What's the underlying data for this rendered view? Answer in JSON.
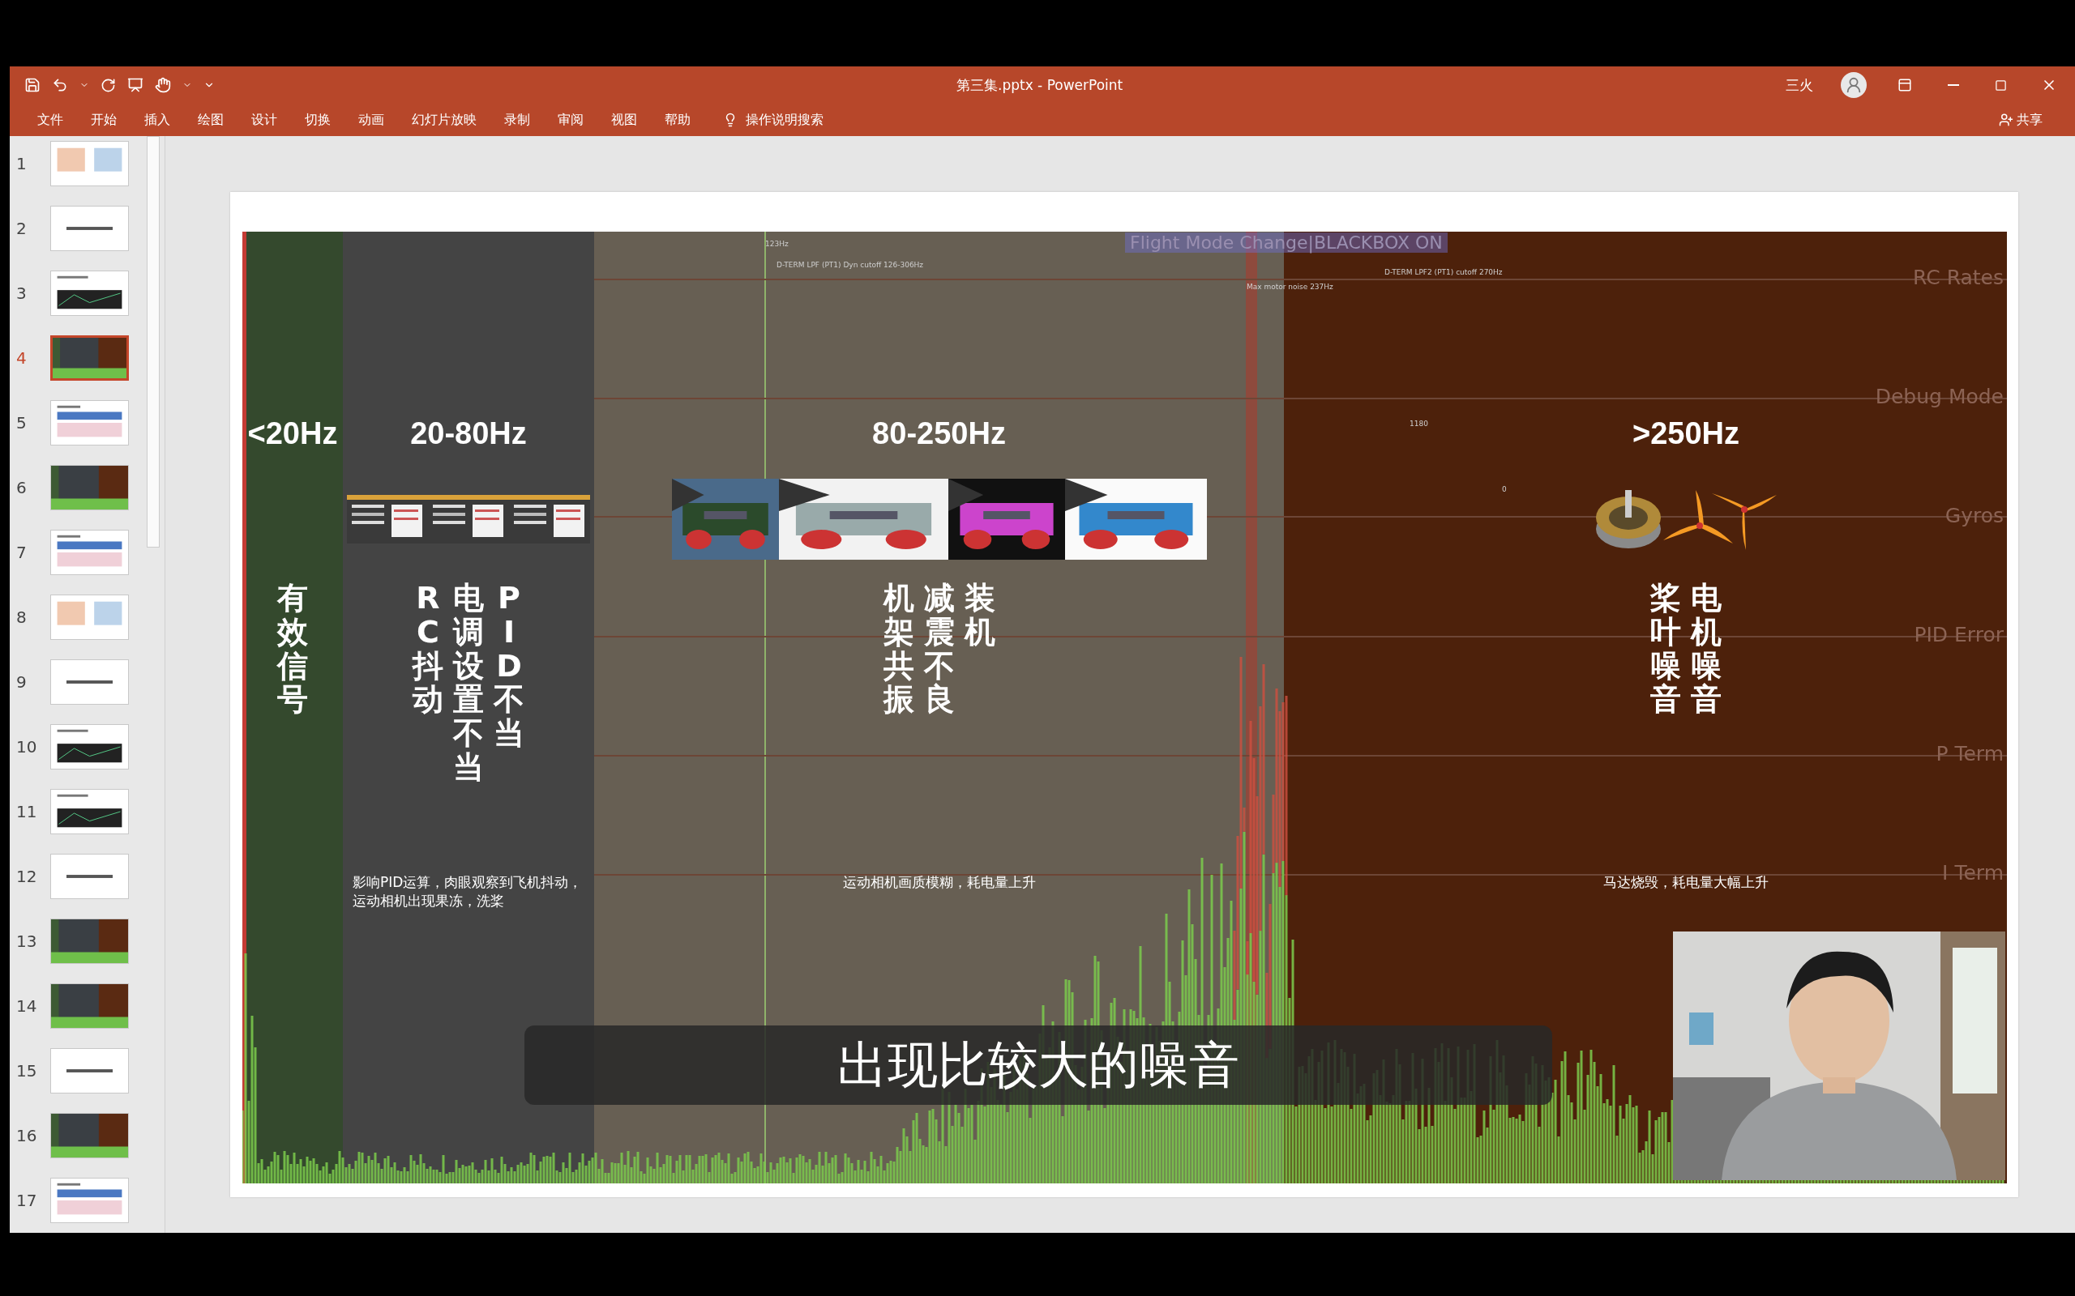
{
  "window": {
    "title": "第三集.pptx - PowerPoint",
    "user": "三火"
  },
  "ribbon": {
    "tabs": [
      "文件",
      "开始",
      "插入",
      "绘图",
      "设计",
      "切换",
      "动画",
      "幻灯片放映",
      "录制",
      "审阅",
      "视图",
      "帮助"
    ],
    "search": "操作说明搜索",
    "share": "共享"
  },
  "slides": [
    {
      "number": "1",
      "kind": "diagram",
      "selected": false
    },
    {
      "number": "2",
      "kind": "title",
      "selected": false
    },
    {
      "number": "3",
      "kind": "chart",
      "selected": false
    },
    {
      "number": "4",
      "kind": "dark",
      "selected": true
    },
    {
      "number": "5",
      "kind": "table",
      "selected": false
    },
    {
      "number": "6",
      "kind": "dark",
      "selected": false
    },
    {
      "number": "7",
      "kind": "table",
      "selected": false
    },
    {
      "number": "8",
      "kind": "diagram",
      "selected": false
    },
    {
      "number": "9",
      "kind": "title",
      "selected": false
    },
    {
      "number": "10",
      "kind": "chart",
      "selected": false
    },
    {
      "number": "11",
      "kind": "chart",
      "selected": false
    },
    {
      "number": "12",
      "kind": "title",
      "selected": false
    },
    {
      "number": "13",
      "kind": "dark",
      "selected": false
    },
    {
      "number": "14",
      "kind": "dark",
      "selected": false
    },
    {
      "number": "15",
      "kind": "title",
      "selected": false
    },
    {
      "number": "16",
      "kind": "dark",
      "selected": false
    },
    {
      "number": "17",
      "kind": "table",
      "selected": false
    }
  ],
  "slide": {
    "flight_mode": "Flight Mode Change|BLACKBOX ON",
    "markers": [
      "123Hz",
      "D-TERM LPF (PT1) Dyn cutoff 126-306Hz",
      "Max motor noise 237Hz",
      "D-TERM LPF2 (PT1) cutoff 270Hz",
      "1180",
      "0"
    ],
    "chart_labels": [
      "RC Rates",
      "Debug Mode",
      "Gyros",
      "PID Error",
      "P Term",
      "I Term"
    ],
    "bands": [
      {
        "kind": "signal",
        "heading": "<20Hz",
        "columns": [
          "有效信号"
        ]
      },
      {
        "kind": "control",
        "heading": "20-80Hz",
        "columns": [
          "RC抖动",
          "电调设置不当",
          "PID不当"
        ],
        "note": "影响PID运算，肉眼观察到飞机抖动，运动相机出现果冻，洗桨"
      },
      {
        "kind": "frame",
        "heading": "80-250Hz",
        "columns": [
          "机架共振",
          "减震不良",
          "装机"
        ],
        "note": "运动相机画质模糊，耗电量上升"
      },
      {
        "kind": "motor",
        "heading": ">250Hz",
        "columns": [
          "桨叶噪音",
          "电机噪音"
        ],
        "note": "马达烧毁，耗电量大幅上升"
      }
    ]
  },
  "video": {
    "subtitle": "出现比较大的噪音"
  }
}
